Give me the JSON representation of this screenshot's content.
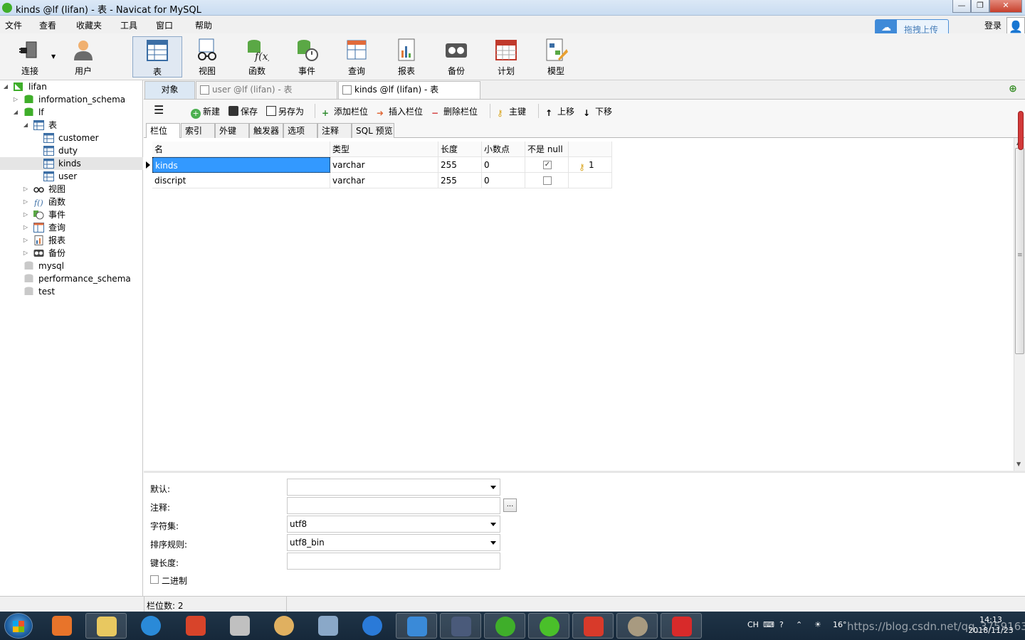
{
  "window": {
    "title": "kinds @lf (lifan) - 表 - Navicat for MySQL"
  },
  "menu": [
    "文件",
    "查看",
    "收藏夹",
    "工具",
    "窗口",
    "帮助"
  ],
  "cloud_upload": {
    "label": "拖拽上传"
  },
  "login": "登录",
  "toolbar": [
    {
      "label": "连接",
      "icon": "connection-icon"
    },
    {
      "label": "用户",
      "icon": "user-icon"
    },
    {
      "label": "表",
      "icon": "table-icon",
      "active": true
    },
    {
      "label": "视图",
      "icon": "view-icon"
    },
    {
      "label": "函数",
      "icon": "function-icon"
    },
    {
      "label": "事件",
      "icon": "event-icon"
    },
    {
      "label": "查询",
      "icon": "query-icon"
    },
    {
      "label": "报表",
      "icon": "report-icon"
    },
    {
      "label": "备份",
      "icon": "backup-icon"
    },
    {
      "label": "计划",
      "icon": "schedule-icon"
    },
    {
      "label": "模型",
      "icon": "model-icon"
    }
  ],
  "tree": [
    {
      "label": "lifan",
      "level": 0,
      "expanded": true,
      "icon": "connection-icon"
    },
    {
      "label": "information_schema",
      "level": 1,
      "icon": "database-icon"
    },
    {
      "label": "lf",
      "level": 1,
      "expanded": true,
      "icon": "database-icon"
    },
    {
      "label": "表",
      "level": 2,
      "expanded": true,
      "icon": "table-icon"
    },
    {
      "label": "customer",
      "level": 3,
      "icon": "table-icon"
    },
    {
      "label": "duty",
      "level": 3,
      "icon": "table-icon"
    },
    {
      "label": "kinds",
      "level": 3,
      "icon": "table-icon",
      "selected": true
    },
    {
      "label": "user",
      "level": 3,
      "icon": "table-icon"
    },
    {
      "label": "视图",
      "level": 2,
      "icon": "view-icon"
    },
    {
      "label": "函数",
      "level": 2,
      "icon": "function-icon"
    },
    {
      "label": "事件",
      "level": 2,
      "icon": "event-icon"
    },
    {
      "label": "查询",
      "level": 2,
      "icon": "query-icon"
    },
    {
      "label": "报表",
      "level": 2,
      "icon": "report-icon"
    },
    {
      "label": "备份",
      "level": 2,
      "icon": "backup-icon"
    },
    {
      "label": "mysql",
      "level": 1,
      "icon": "database-icon"
    },
    {
      "label": "performance_schema",
      "level": 1,
      "icon": "database-icon"
    },
    {
      "label": "test",
      "level": 1,
      "icon": "database-icon"
    }
  ],
  "doc_tabs": {
    "objects": "对象",
    "user_tab": "user @lf (lifan) - 表",
    "kinds_tab": "kinds @lf (lifan) - 表"
  },
  "editor_toolbar": {
    "new": "新建",
    "save": "保存",
    "save_as": "另存为",
    "add_column": "添加栏位",
    "insert_column": "插入栏位",
    "delete_column": "删除栏位",
    "primary_key": "主键",
    "move_up": "上移",
    "move_down": "下移"
  },
  "sub_tabs": [
    "栏位",
    "索引",
    "外键",
    "触发器",
    "选项",
    "注释",
    "SQL 预览"
  ],
  "grid": {
    "headers": [
      "名",
      "类型",
      "长度",
      "小数点",
      "不是 null",
      ""
    ],
    "rows": [
      {
        "name": "kinds",
        "type": "varchar",
        "length": "255",
        "decimals": "0",
        "not_null": true,
        "key": "1"
      },
      {
        "name": "discript",
        "type": "varchar",
        "length": "255",
        "decimals": "0",
        "not_null": false,
        "key": ""
      }
    ]
  },
  "properties": {
    "default_label": "默认:",
    "default_value": "",
    "comment_label": "注释:",
    "comment_value": "",
    "ellipsis": "...",
    "charset_label": "字符集:",
    "charset_value": "utf8",
    "collation_label": "排序规则:",
    "collation_value": "utf8_bin",
    "key_length_label": "键长度:",
    "key_length_value": "",
    "binary_label": "二进制"
  },
  "status": {
    "column_count": "栏位数: 2"
  },
  "taskbar": {
    "ime": "CH",
    "temperature": "16°",
    "time": "14:13",
    "date": "2018/11/23",
    "watermark": "https://blog.csdn.net/qq_37591637"
  }
}
